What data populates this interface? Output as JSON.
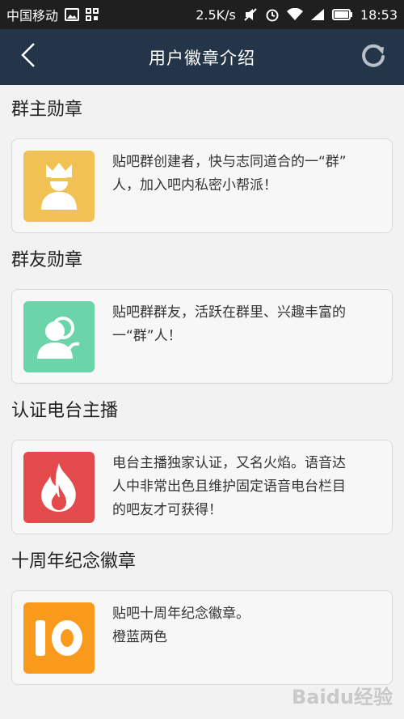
{
  "status_bar": {
    "carrier": "中国移动",
    "speed": "2.5K/s",
    "time": "18:53",
    "icons": [
      "image-icon",
      "grid-icon",
      "mute-icon",
      "alarm-icon",
      "wifi-icon",
      "signal-icon",
      "battery-icon"
    ]
  },
  "nav": {
    "title": "用户徽章介绍",
    "back_icon": "chevron-left-icon",
    "refresh_icon": "refresh-icon"
  },
  "sections": [
    {
      "title": "群主勋章",
      "badge_icon": "crown-person-icon",
      "badge_color": "#f2c154",
      "desc_lines": [
        "贴吧群创建者，快与志同道合的一“群”",
        "人，加入吧内私密小帮派！"
      ]
    },
    {
      "title": "群友勋章",
      "badge_icon": "group-people-icon",
      "badge_color": "#6cd4a9",
      "desc_lines": [
        "贴吧群群友，活跃在群里、兴趣丰富的",
        "一“群”人！"
      ]
    },
    {
      "title": "认证电台主播",
      "badge_icon": "flame-icon",
      "badge_color": "#e24a4c",
      "desc_lines": [
        "电台主播独家认证，又名火焰。语音达",
        "人中非常出色且维护固定语音电台栏目",
        "的吧友才可获得！"
      ]
    },
    {
      "title": "十周年纪念徽章",
      "badge_icon": "ten-anniversary-icon",
      "badge_color": "#f99a1c",
      "desc_lines": [
        "贴吧十周年纪念徽章。",
        "橙蓝两色"
      ]
    }
  ],
  "watermark": "Baidu经验"
}
